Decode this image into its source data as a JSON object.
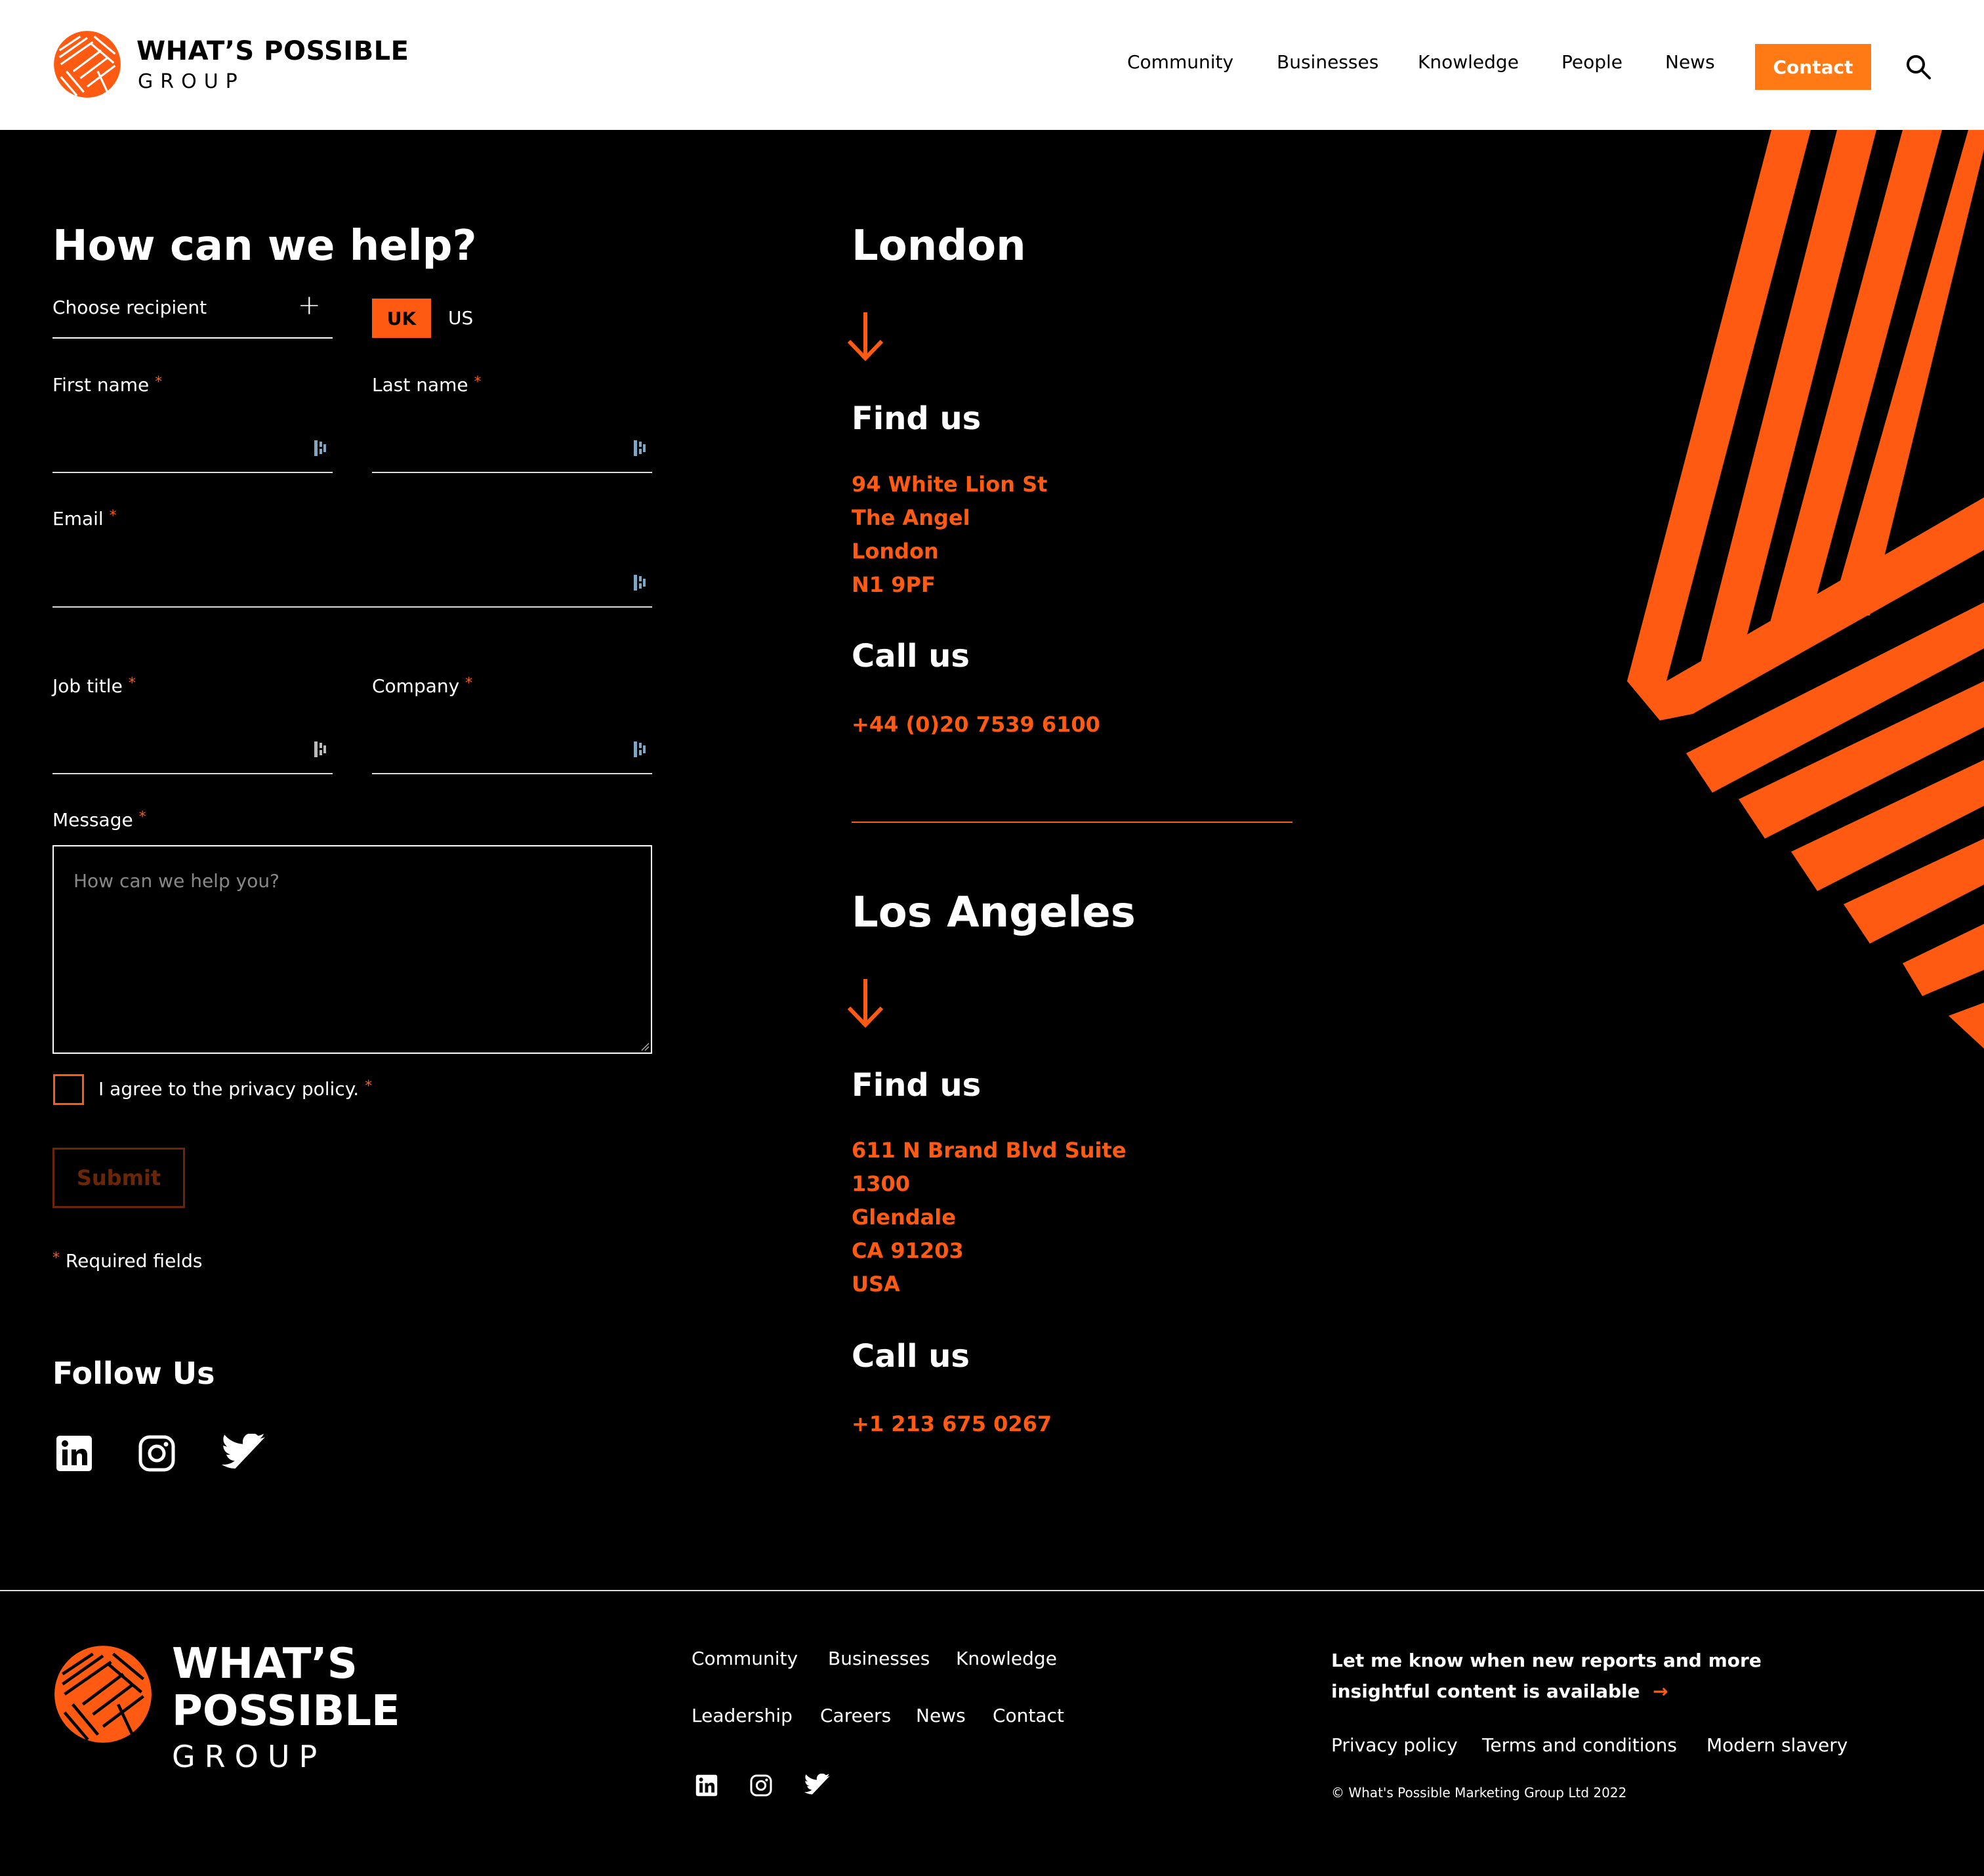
{
  "brand": {
    "name_line1": "WHAT’S POSSIBLE",
    "name_line2": "GROUP",
    "footer_line1": "WHAT’S",
    "footer_line2": "POSSIBLE",
    "footer_line3": "GROUP",
    "accent": "#ff5a12",
    "button_orange": "#ff7a15"
  },
  "nav": {
    "items": [
      "Community",
      "Businesses",
      "Knowledge",
      "People",
      "News"
    ],
    "contact_label": "Contact",
    "search_icon": "search-icon"
  },
  "form": {
    "title": "How can we help?",
    "recipient_label": "Choose recipient",
    "recipient_icon": "plus-icon",
    "region_uk": "UK",
    "region_us": "US",
    "selected_region": "UK",
    "required_mark": "*",
    "first_name_label": "First name",
    "last_name_label": "Last name",
    "email_label": "Email",
    "job_title_label": "Job title",
    "company_label": "Company",
    "message_label": "Message",
    "message_placeholder": "How can we help you?",
    "privacy_label": "I agree to the privacy policy.",
    "privacy_checked": false,
    "submit_label": "Submit",
    "required_note": "Required fields",
    "first_name_value": "",
    "last_name_value": "",
    "email_value": "",
    "job_title_value": "",
    "company_value": ""
  },
  "follow": {
    "title": "Follow Us",
    "icons": [
      "linkedin-icon",
      "instagram-icon",
      "twitter-icon"
    ]
  },
  "locations": [
    {
      "city": "London",
      "find_title": "Find us",
      "address": [
        "94 White Lion St",
        "The Angel",
        "London",
        "N1 9PF"
      ],
      "call_title": "Call us",
      "phone": "+44 (0)20 7539 6100"
    },
    {
      "city": "Los Angeles",
      "find_title": "Find us",
      "address": [
        "611 N Brand Blvd Suite",
        "1300",
        "Glendale",
        "CA 91203",
        "USA"
      ],
      "call_title": "Call us",
      "phone": "+1 213 675 0267"
    }
  ],
  "footer": {
    "links_row1": [
      "Community",
      "Businesses",
      "Knowledge"
    ],
    "links_row2": [
      "Leadership",
      "Careers",
      "News",
      "Contact"
    ],
    "newsletter_line1": "Let me know when new reports and more",
    "newsletter_line2": "insightful content is available",
    "newsletter_arrow": "→",
    "legal": [
      "Privacy policy",
      "Terms and conditions",
      "Modern slavery"
    ],
    "copyright": "© What's Possible Marketing Group Ltd 2022"
  }
}
